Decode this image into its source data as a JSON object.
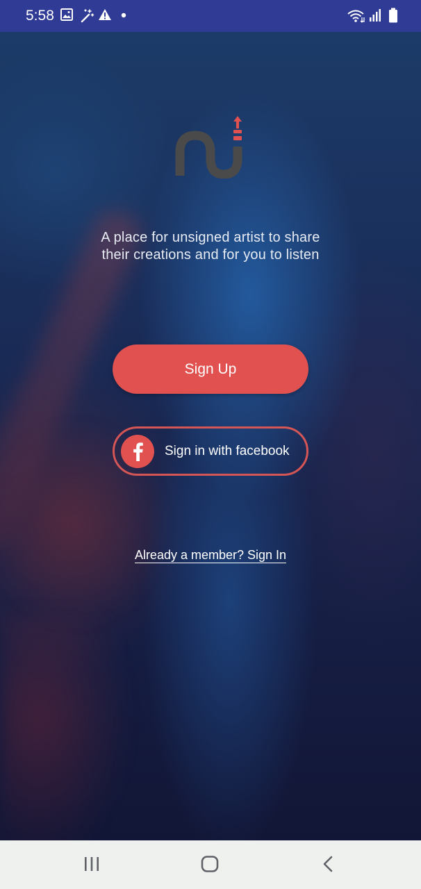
{
  "status_bar": {
    "time": "5:58",
    "icons": [
      "image-icon",
      "magic-wand-icon",
      "warning-icon",
      "dot-icon",
      "wifi-icon",
      "signal-icon",
      "battery-icon"
    ]
  },
  "logo": {
    "name": "app-logo",
    "colors": {
      "letters": "#4a4a4a",
      "accent": "#e05150"
    }
  },
  "tagline": {
    "line1": "A place for unsigned artist to share",
    "line2": "their creations and for you to listen"
  },
  "buttons": {
    "signup_label": "Sign Up",
    "facebook_label": "Sign in with facebook",
    "facebook_icon": "facebook-icon"
  },
  "signin": {
    "label": "Already a member? Sign In"
  },
  "nav": {
    "icons": [
      "recents-icon",
      "home-icon",
      "back-icon"
    ]
  },
  "colors": {
    "status_bar": "#2f3b94",
    "accent": "#e05150",
    "nav_bar": "#eef1ee"
  }
}
